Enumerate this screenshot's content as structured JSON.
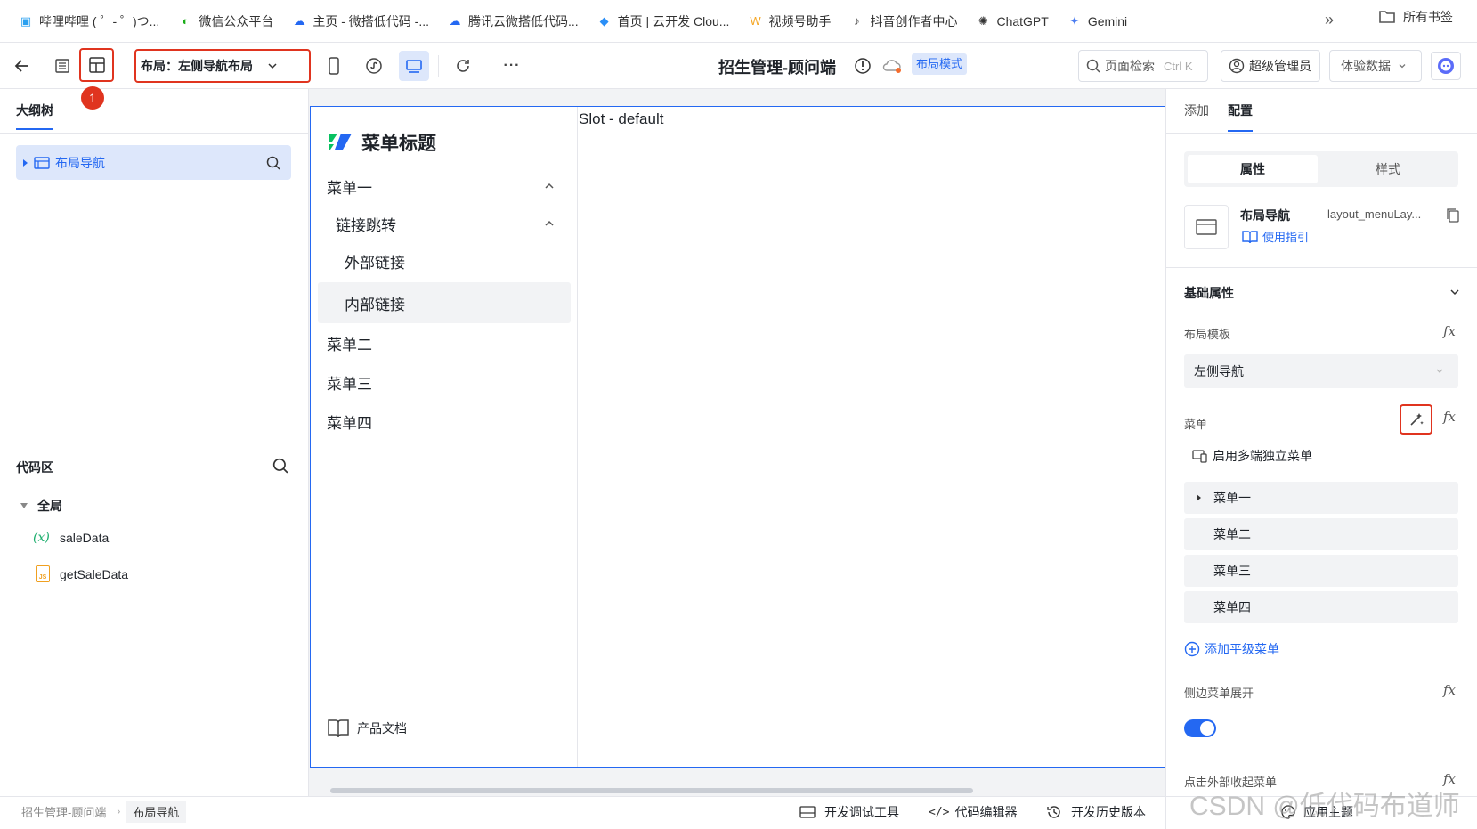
{
  "bookmarks": [
    {
      "label": "哔哩哔哩 ( ゜- ゜)つ...",
      "icon": "bilibili-icon",
      "color": "#2aa0f0"
    },
    {
      "label": "微信公众平台",
      "icon": "wechat-icon",
      "color": "#1aad19"
    },
    {
      "label": "主页 - 微搭低代码 -...",
      "icon": "cloud-icon",
      "color": "#2468f2"
    },
    {
      "label": "腾讯云微搭低代码...",
      "icon": "cloud-icon",
      "color": "#2468f2"
    },
    {
      "label": "首页 | 云开发 Clou...",
      "icon": "cloudbase-icon",
      "color": "#2a8ff7"
    },
    {
      "label": "视频号助手",
      "icon": "channels-icon",
      "color": "#f5a623"
    },
    {
      "label": "抖音创作者中心",
      "icon": "douyin-icon",
      "color": "#111111"
    },
    {
      "label": "ChatGPT",
      "icon": "chatgpt-icon",
      "color": "#333333"
    },
    {
      "label": "Gemini",
      "icon": "gemini-icon",
      "color": "#4a7cf0"
    }
  ],
  "bookmarks_more": "»",
  "all_bookmarks": "所有书签",
  "toolbar": {
    "layout_select": "布局：左侧导航布局",
    "badge_number": "1",
    "app_title": "招生管理-顾问端",
    "mode_tag": "布局模式",
    "search_label": "页面检索",
    "search_shortcut": "Ctrl K",
    "admin_label": "超级管理员",
    "data_label": "体验数据",
    "more": "···"
  },
  "left": {
    "outline_title": "大纲树",
    "tree_item": "布局导航",
    "code_title": "代码区",
    "global_label": "全局",
    "code_items": [
      {
        "label": "saleData",
        "icon": "variable-icon",
        "glyph": "(x)"
      },
      {
        "label": "getSaleData",
        "icon": "js-file-icon",
        "glyph": "JS"
      }
    ]
  },
  "canvas": {
    "menu_title": "菜单标题",
    "slot_text": "Slot - default",
    "menu1": "菜单一",
    "submenu": "链接跳转",
    "link_external": "外部链接",
    "link_internal": "内部链接",
    "menu2": "菜单二",
    "menu3": "菜单三",
    "menu4": "菜单四",
    "docs": "产品文档"
  },
  "right": {
    "tab_add": "添加",
    "tab_config": "配置",
    "seg_props": "属性",
    "seg_style": "样式",
    "comp_name": "布局导航",
    "comp_id": "layout_menuLay...",
    "guide": "使用指引",
    "section_basic": "基础属性",
    "label_template": "布局模板",
    "template_value": "左侧导航",
    "label_menu": "菜单",
    "multi_menu": "启用多端独立菜单",
    "menu_items": [
      "菜单一",
      "菜单二",
      "菜单三",
      "菜单四"
    ],
    "add_menu": "添加平级菜单",
    "label_expand": "侧边菜单展开",
    "expand_on": true,
    "label_collapse": "点击外部收起菜单",
    "fx": "fx"
  },
  "footer": {
    "crumb1": "招生管理-顾问端",
    "crumb2": "布局导航",
    "debug": "开发调试工具",
    "code_editor": "代码编辑器",
    "history": "开发历史版本",
    "theme": "应用主题"
  },
  "watermark": "CSDN @低代码布道师",
  "colors": {
    "accent": "#2468f2",
    "highlight_red": "#e0341f",
    "selected_bg": "#dde7fb",
    "brand_green": "#07c160"
  }
}
